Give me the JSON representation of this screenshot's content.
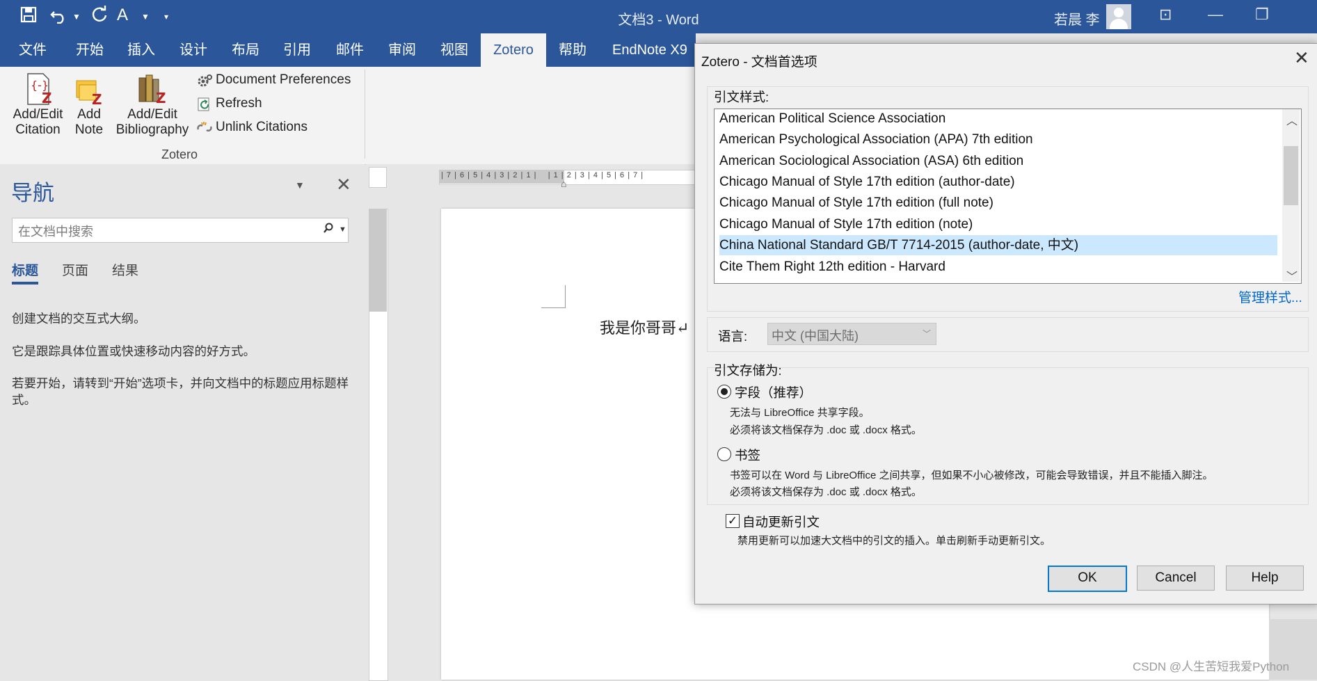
{
  "window": {
    "doc_title": "文档3 - Word",
    "user_name": "若晨 李"
  },
  "ribbon": {
    "tabs": [
      "文件",
      "开始",
      "插入",
      "设计",
      "布局",
      "引用",
      "邮件",
      "审阅",
      "视图",
      "Zotero",
      "帮助",
      "EndNote X9"
    ],
    "active_tab": "Zotero",
    "buttons": {
      "add_edit_citation": "Add/Edit Citation",
      "add_note": "Add Note",
      "add_edit_bibliography": "Add/Edit Bibliography",
      "document_preferences": "Document Preferences",
      "refresh": "Refresh",
      "unlink_citations": "Unlink Citations"
    },
    "group_label": "Zotero"
  },
  "navigation": {
    "title": "导航",
    "search_placeholder": "在文档中搜索",
    "tabs": [
      "标题",
      "页面",
      "结果"
    ],
    "active_tab": "标题",
    "text1": "创建文档的交互式大纲。",
    "text2": "它是跟踪具体位置或快速移动内容的好方式。",
    "text3": "若要开始，请转到“开始”选项卡，并向文档中的标题应用标题样式。"
  },
  "document": {
    "body_text": "我是你哥哥↵"
  },
  "dialog": {
    "title": "Zotero - 文档首选项",
    "citation_style_label": "引文样式:",
    "styles": [
      "American Political Science Association",
      "American Psychological Association (APA) 7th edition",
      "American Sociological Association (ASA) 6th edition",
      "Chicago Manual of Style 17th edition (author-date)",
      "Chicago Manual of Style 17th edition (full note)",
      "Chicago Manual of Style 17th edition (note)",
      "China National Standard GB/T 7714-2015 (author-date, 中文)",
      "Cite Them Right 12th edition - Harvard"
    ],
    "selected_style_index": 6,
    "manage_styles": "管理样式...",
    "language_label": "语言:",
    "language_value": "中文 (中国大陆)",
    "store_as_label": "引文存储为:",
    "option_fields": "字段（推荐）",
    "fields_note1": "无法与 LibreOffice 共享字段。",
    "fields_note2": "必须将该文档保存为 .doc 或 .docx 格式。",
    "option_bookmarks": "书签",
    "bookmarks_note1": "书签可以在 Word 与 LibreOffice 之间共享，但如果不小心被修改，可能会导致错误，并且不能插入脚注。",
    "bookmarks_note2": "必须将该文档保存为 .doc 或 .docx 格式。",
    "auto_update": "自动更新引文",
    "auto_update_note": "禁用更新可以加速大文档中的引文的插入。单击刷新手动更新引文。",
    "auto_update_checked": true,
    "ok": "OK",
    "cancel": "Cancel",
    "help": "Help"
  },
  "watermark": "CSDN @人生苦短我爱Python"
}
